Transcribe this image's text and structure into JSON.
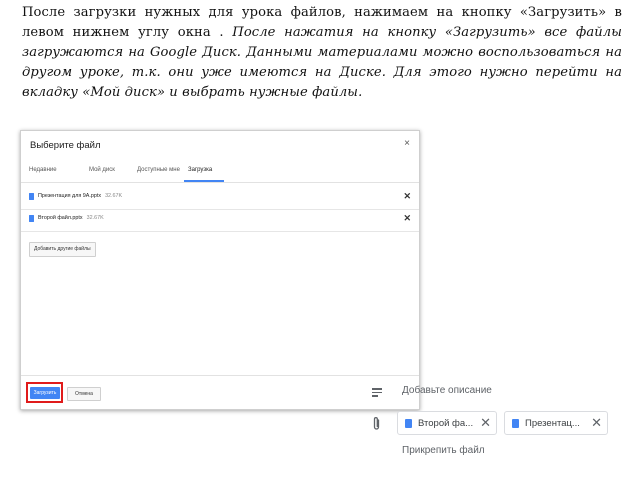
{
  "paragraph": {
    "normal": "После загрузки нужных для урока файлов, нажимаем на кнопку «Загрузить» в левом нижнем углу окна . ",
    "italic": "После нажатия на кнопку «Загрузить» все файлы загружаются на Google Диск. Данными материалами можно воспользоваться на другом уроке, т.к. они уже имеются на Диске. Для этого нужно перейти на вкладку «Мой диск» и выбрать нужные файлы."
  },
  "dialog": {
    "title": "Выберите файл",
    "close": "×",
    "tabs": [
      "Недавние",
      "Мой диск",
      "Доступные мне",
      "Загрузка"
    ],
    "files": [
      {
        "name": "Презентация для 9А.pptx",
        "size": "32.67K"
      },
      {
        "name": "Второй файл.pptx",
        "size": "32.67K"
      }
    ],
    "add_more": "Добавить другие файлы",
    "upload": "Загрузить",
    "cancel": "Отмена"
  },
  "classroom": {
    "description": "Добавьте описание",
    "chips": [
      "Второй фа...",
      "Презентац..."
    ],
    "attach": "Прикрепить файл"
  },
  "colors": {
    "accent": "#4285f4",
    "highlight": "#e01b1b"
  }
}
